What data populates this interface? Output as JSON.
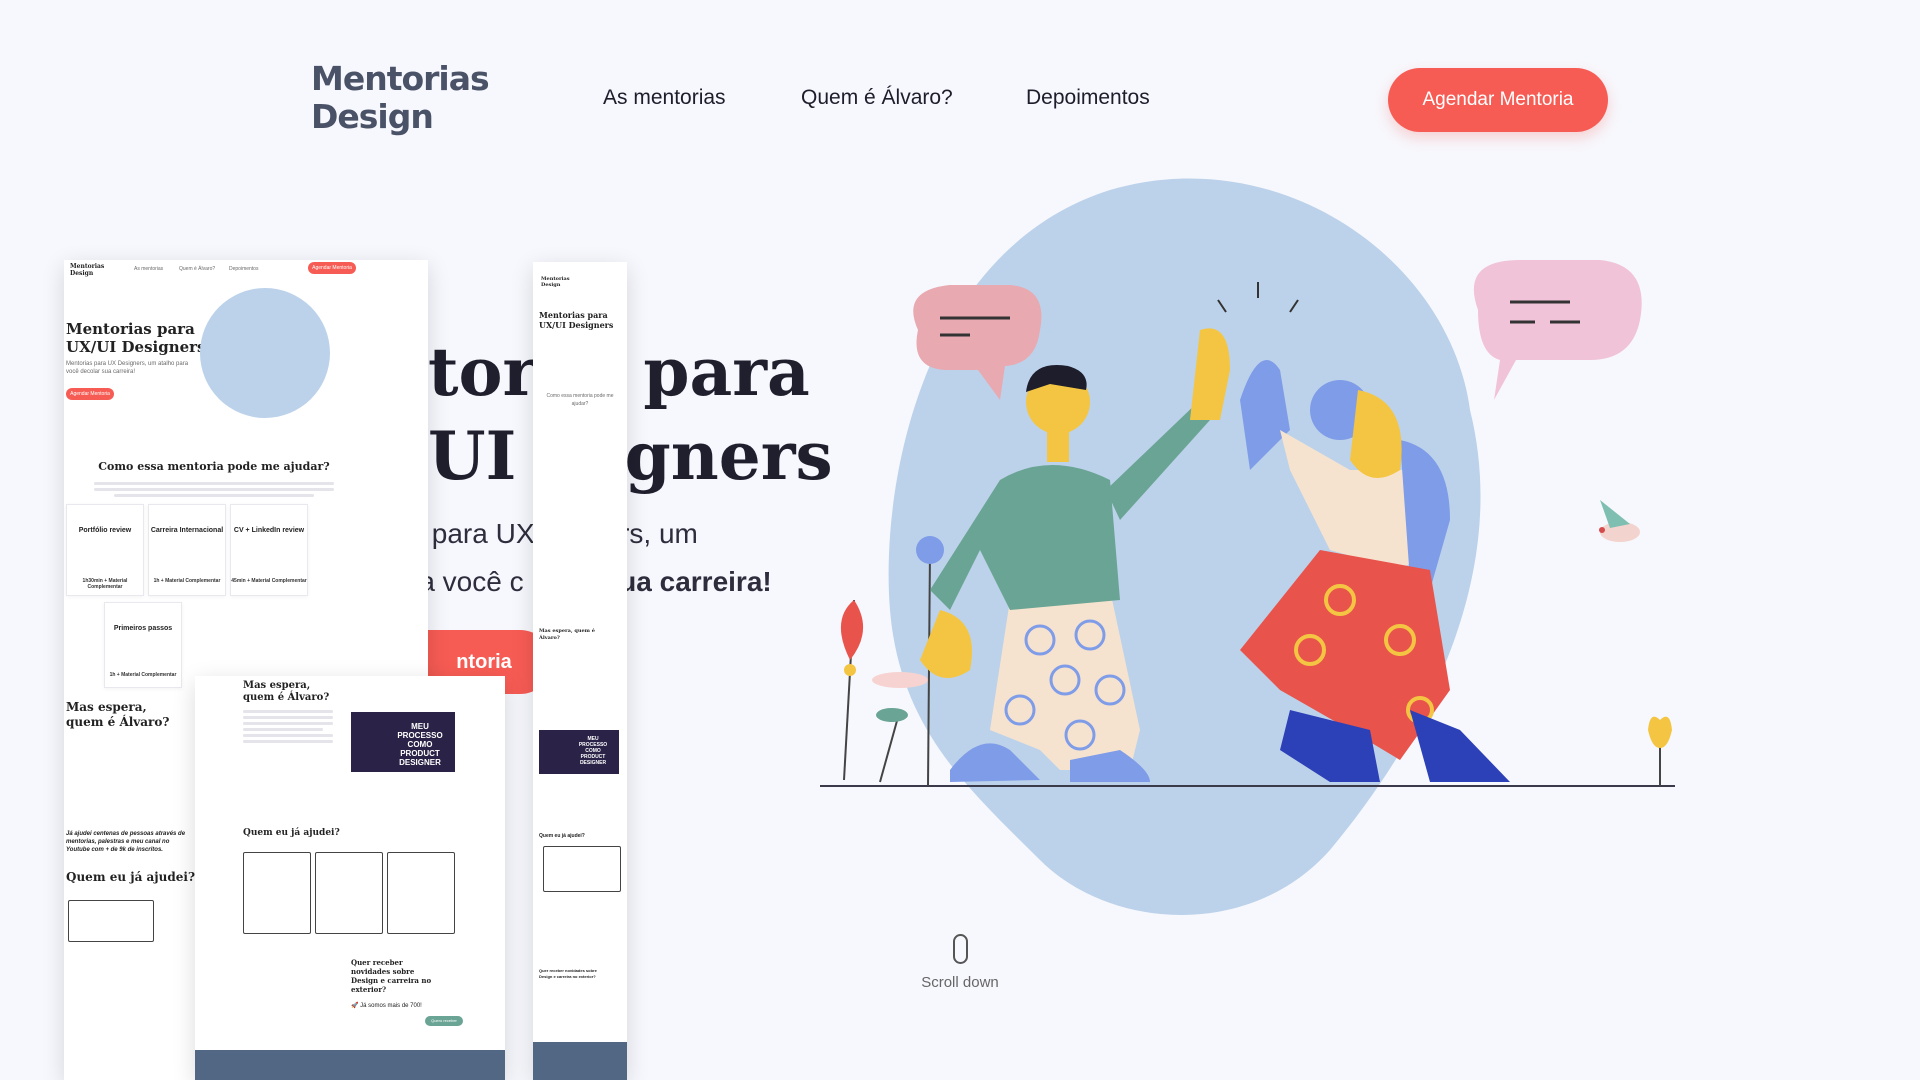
{
  "header": {
    "logo_line1": "Mentorias",
    "logo_line2": "Design",
    "nav": [
      "As mentorias",
      "Quem é Álvaro?",
      "Depoimentos"
    ],
    "cta": "Agendar Mentoria"
  },
  "hero": {
    "title_line1": "ntor  s para",
    "title_line2": "UI  signers",
    "sub_line1": "s para UX       ners, um",
    "sub_line2_a": "ra você c",
    "sub_line2_b": "sua carreira!",
    "button": "ntoria"
  },
  "scroll": {
    "label": "Scroll down"
  },
  "mock_desktop": {
    "logo": "Mentorias Design",
    "nav": [
      "As mentorias",
      "Quem é Álvaro?",
      "Depoimentos"
    ],
    "cta": "Agendar Mentoria",
    "title": "Mentorias para UX/UI Designers",
    "subtitle": "Mentorias para UX Designers, um atalho para você decolar sua carreira!",
    "button": "Agendar Mentoria",
    "section_title": "Como essa mentoria pode me ajudar?",
    "cards": [
      {
        "title": "Portfólio review",
        "foot": "1h30min + Material Complementar"
      },
      {
        "title": "Carreira Internacional",
        "foot": "1h + Material Complementar"
      },
      {
        "title": "CV + LinkedIn review",
        "foot": "45min + Material Complementar"
      },
      {
        "title": "Primeiros passos",
        "foot": "1h + Material Complementar"
      }
    ],
    "about_title": "Mas espera, quem é Álvaro?",
    "quote": "Já ajudei centenas de pessoas através de mentorias, palestras e meu canal no Youtube com + de 9k de inscritos.",
    "testimonials_title": "Quem eu já ajudei?"
  },
  "mock_tablet": {
    "about_title": "Mas espera, quem é Álvaro?",
    "video_title": "MEU PROCESSO COMO PRODUCT DESIGNER",
    "testimonials_title": "Quem eu já ajudei?",
    "newsletter_title": "Quer receber novidades sobre Design e carreira no exterior?",
    "newsletter_note": "🚀 Já somos mais de 700!",
    "newsletter_btn": "Quero receber"
  },
  "mock_mobile": {
    "logo": "Mentorias Design",
    "title": "Mentorias para UX/UI Designers",
    "section_title": "Como essa mentoria pode me ajudar?",
    "about_title": "Mas espera, quem é Álvaro?",
    "video_title": "MEU PROCESSO COMO PRODUCT DESIGNER",
    "testimonials_title": "Quem eu já ajudei?",
    "newsletter_title": "Quer receber novidades sobre Design e carreira no exterior?"
  },
  "colors": {
    "accent": "#f75c54",
    "background": "#f7f8fd",
    "blob": "#bcd2ea",
    "logo": "#4a5268"
  }
}
